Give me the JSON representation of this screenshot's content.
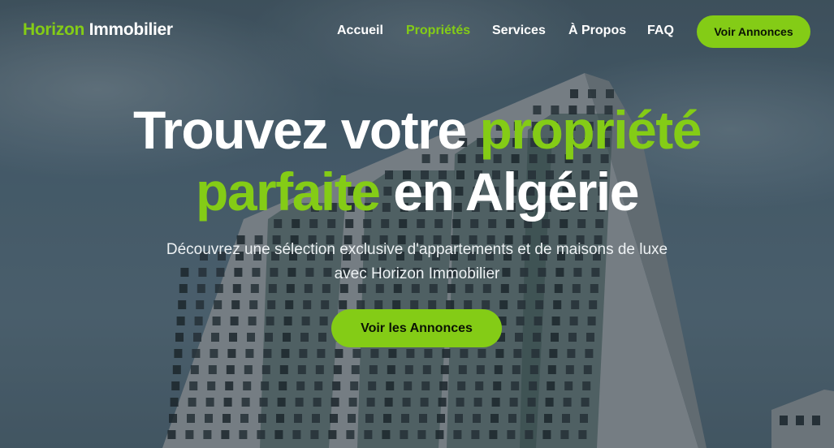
{
  "brand": {
    "name_part1": "Horizon",
    "name_part2": "Immobilier"
  },
  "nav": {
    "items": [
      {
        "label": "Accueil",
        "active": false
      },
      {
        "label": "Propriétés",
        "active": true
      },
      {
        "label": "Services",
        "active": false
      },
      {
        "label": "À Propos",
        "active": false
      },
      {
        "label": "FAQ",
        "active": false
      }
    ],
    "cta_label": "Voir Annonces"
  },
  "hero": {
    "title_line1_a": "Trouvez votre ",
    "title_line1_b": "propriété",
    "title_line2_a": "parfaite",
    "title_line2_b": " en Algérie",
    "subtitle_line1": "Découvrez une sélection exclusive d'appartements et de maisons de luxe",
    "subtitle_line2": "avec Horizon Immobilier",
    "cta_label": "Voir les Annonces",
    "background_image": "apartment-tower-building"
  },
  "colors": {
    "accent": "#84cc16",
    "text_light": "#ffffff",
    "button_text": "#0b1304"
  }
}
